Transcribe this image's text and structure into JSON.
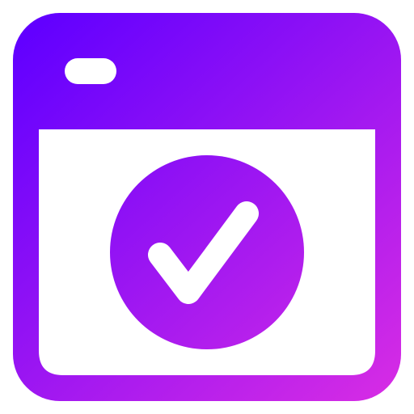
{
  "icon": {
    "name": "browser-window-check-icon",
    "colors": {
      "gradient_start": "#6200FF",
      "gradient_end": "#D42BE5",
      "window_fill": "#FFFFFF"
    }
  }
}
